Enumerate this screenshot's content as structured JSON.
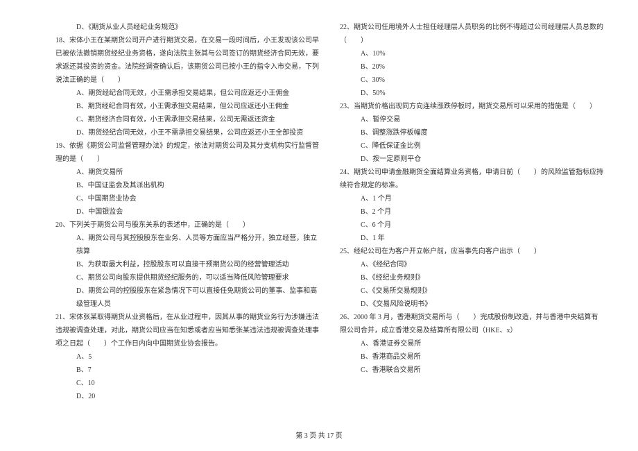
{
  "left": {
    "q17_d": "D、《期货从业人员经纪业务规范》",
    "q18": "18、宋体小王在某期货公司开户进行期货交易，在交易一段时间后，小王发现该公司早已被依法撤销期货经纪业务资格，遂向法院主张其与公司签订的期货经济合同无效，要求返还其投资的资金。法院经调查确认后，该期货公司已按小王的指令入市交易，下列说法正确的是（　　）",
    "q18_a": "A、期货经纪合同无效，小王需承担交易结果，但公司应返还小王佣金",
    "q18_b": "B、期货经纪合同有效，小王需承担交易结果，但公司应返还小王佣金",
    "q18_c": "C、期货经济合同有效，小王需承担交易结果，公司无需返还资金",
    "q18_d": "D、期货经纪合同无效，小王不需承担交易结果，公司应返还小王全部投资",
    "q19": "19、依据《期货公司监督管理办法》的规定，依法对期货公司及其分支机构实行监督管理的是（　　）",
    "q19_a": "A、期货交易所",
    "q19_b": "B、中国证监会及其派出机构",
    "q19_c": "C、中国期货业协会",
    "q19_d": "D、中国银监会",
    "q20": "20、下列关于期货公司与股东关系的表述中，正确的是（　　）",
    "q20_a": "A、期货公司与其控股股东在业务、人员等方面应当严格分开，独立经营，独立核算",
    "q20_b": "B、为获取最大利益，控股股东可以直接干预期货公司的经营管理活动",
    "q20_c": "C、期货公司向股东提供期货经纪服务的，可以适当降低风险管理要求",
    "q20_d": "D、期货公司的控股股东在紧急情况下可以直接任免期货公司的董事、监事和高级管理人员",
    "q21": "21、宋体张某取得期货从业资格后，在从业过程中，因其从事的期货业务行为涉嫌违法违规被调查处理，对此，期货公司应当在知悉或者应当知悉张某违法违规被调查处理事项之日起（　　）个工作日内向中国期货业协会报告。",
    "q21_a": "A、5",
    "q21_b": "B、7",
    "q21_c": "C、10",
    "q21_d": "D、20"
  },
  "right": {
    "q22": "22、期货公司任用境外人士担任经理层人员职务的比例不得超过公司经理层人员总数的（　　）",
    "q22_a": "A、10%",
    "q22_b": "B、20%",
    "q22_c": "C、30%",
    "q22_d": "D、50%",
    "q23": "23、当期货价格出现同方向连续涨跌停板时，期货交易所可以采用的措施是（　　）",
    "q23_a": "A、暂停交易",
    "q23_b": "B、调整涨跌停板幅度",
    "q23_c": "C、降低保证金比例",
    "q23_d": "D、按一定原则平仓",
    "q24": "24、期货公司申请金融期货全面结算业务资格，申请日前（　　）的风险监管指标应持续符合规定的标准。",
    "q24_a": "A、1 个月",
    "q24_b": "B、2 个月",
    "q24_c": "C、6 个月",
    "q24_d": "D、1 年",
    "q25": "25、经纪公司在为客户开立帐户前，应当事先向客户出示（　　）",
    "q25_a": "A、《经纪合同》",
    "q25_b": "B、《经纪业务规则》",
    "q25_c": "C、《交易所交易规则》",
    "q25_d": "D、《交易风险说明书》",
    "q26": "26、2000 年 3 月，香港期货交易所与（　　）完成股份制改造，并与香港中央结算有限公司合并，成立香港交易及结算所有限公司（HKE、x）",
    "q26_a": "A、香港证券交易所",
    "q26_b": "B、香港商品交易所",
    "q26_c": "C、香港联合交易所"
  },
  "footer": "第 3 页 共 17 页"
}
